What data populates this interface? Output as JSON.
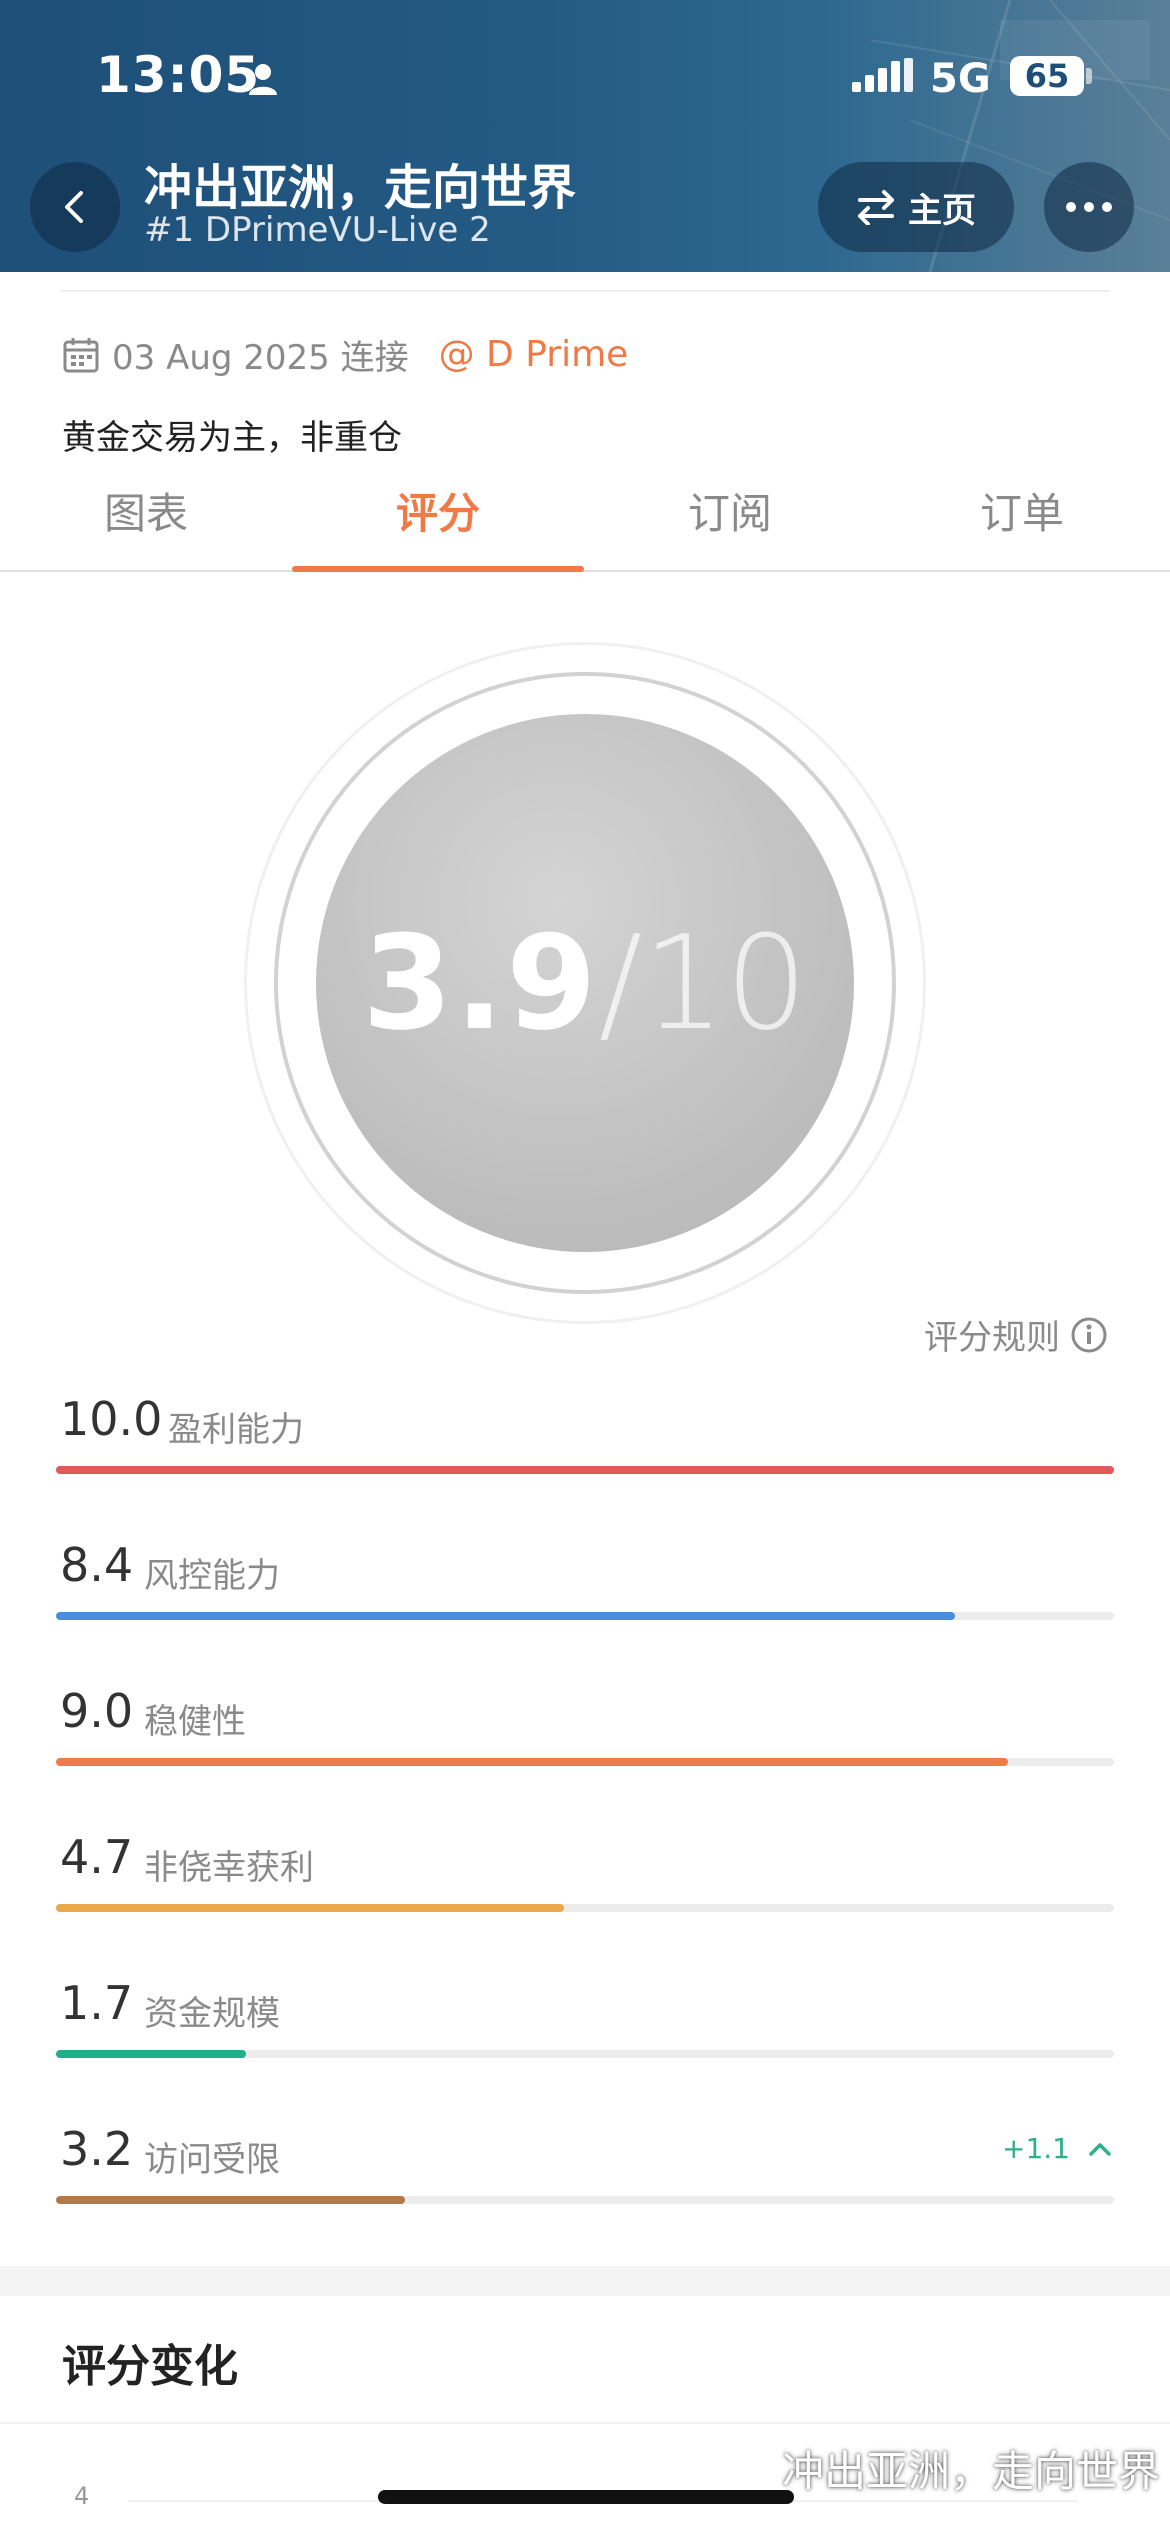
{
  "status_bar": {
    "time": "13:05",
    "network": "5G",
    "battery": "65"
  },
  "header": {
    "title": "冲出亚洲，走向世界",
    "subtitle": "#1 DPrimeVU-Live 2",
    "home_label": "主页",
    "icons": [
      "back-arrow-icon",
      "swap-icon",
      "more-icon"
    ]
  },
  "info": {
    "date": "03 Aug 2025 连接",
    "provider": "@ D Prime",
    "description": "黄金交易为主，非重仓"
  },
  "tabs": [
    {
      "label": "图表",
      "active": false
    },
    {
      "label": "评分",
      "active": true
    },
    {
      "label": "订阅",
      "active": false
    },
    {
      "label": "订单",
      "active": false
    }
  ],
  "score": {
    "value": "3.9",
    "total": "/10"
  },
  "rules_label": "评分规则",
  "metrics": [
    {
      "value": "10.0",
      "label": "盈利能力",
      "fraction": 1.0,
      "color": "#e05a5a"
    },
    {
      "value": "8.4",
      "label": "风控能力",
      "fraction": 0.85,
      "color": "#4a8de0"
    },
    {
      "value": "9.0",
      "label": "稳健性",
      "fraction": 0.9,
      "color": "#ef7a4a"
    },
    {
      "value": "4.7",
      "label": "非侥幸获利",
      "fraction": 0.48,
      "color": "#eba84a"
    },
    {
      "value": "1.7",
      "label": "资金规模",
      "fraction": 0.18,
      "color": "#1fb08a"
    },
    {
      "value": "3.2",
      "label": "访问受限",
      "fraction": 0.33,
      "color": "#b27a4a",
      "change": "+1.1"
    }
  ],
  "section": {
    "title": "评分变化",
    "axis_tick": "4"
  },
  "watermark": "冲出亚洲，走向世界",
  "colors": {
    "accent": "#ef7a45",
    "header_bg": "#235a84",
    "positive": "#2ab28a"
  }
}
